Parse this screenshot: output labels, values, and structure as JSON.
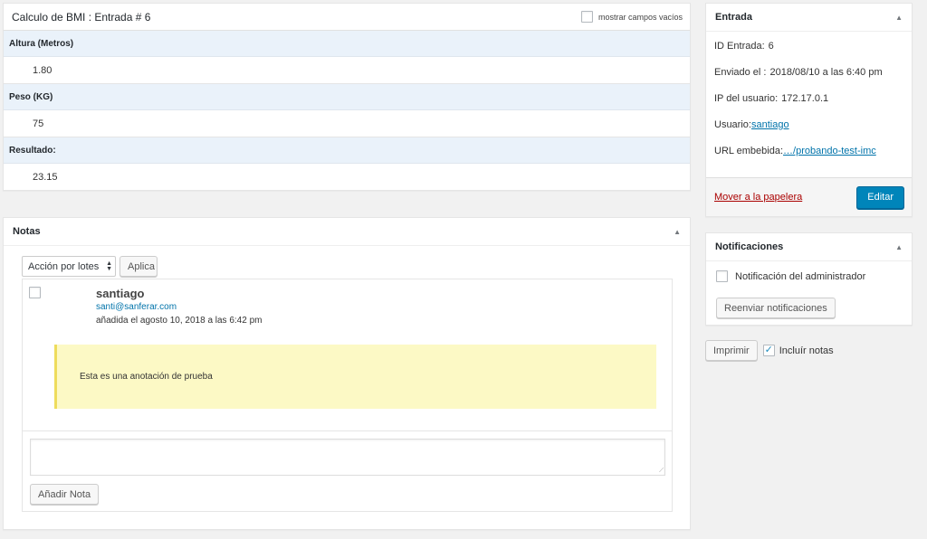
{
  "entry": {
    "title": "Calculo de BMI : Entrada # 6",
    "show_empty_label": "mostrar campos vacíos",
    "fields": [
      {
        "label": "Altura (Metros)",
        "value": "1.80"
      },
      {
        "label": "Peso (KG)",
        "value": "75"
      },
      {
        "label": "Resultado:",
        "value": "23.15"
      }
    ]
  },
  "notes": {
    "title": "Notas",
    "bulk_select": "Acción por lotes",
    "apply_label": "Aplica",
    "note": {
      "author": "santiago",
      "email": "santi@sanferar.com",
      "date": "añadida el agosto 10, 2018 a las 6:42 pm",
      "text": "Esta es una anotación de prueba"
    },
    "add_note_label": "Añadir Nota"
  },
  "entrada": {
    "title": "Entrada",
    "id_label": "ID Entrada:",
    "id_value": "6",
    "sent_label": "Enviado el :",
    "sent_value": "2018/08/10 a las 6:40 pm",
    "ip_label": "IP del usuario:",
    "ip_value": "172.17.0.1",
    "user_label": "Usuario:",
    "user_value": "santiago",
    "url_label": "URL embebida:",
    "url_value": "…/probando-test-imc",
    "trash_label": "Mover a la papelera",
    "edit_label": "Editar"
  },
  "notifications": {
    "title": "Notificaciones",
    "admin_label": "Notificación del administrador",
    "resend_label": "Reenviar notificaciones"
  },
  "print": {
    "print_label": "Imprimir",
    "include_notes_label": "Incluír notas",
    "include_notes_checked": true
  },
  "icons": {
    "toggle": "triangle-up-icon",
    "select_arrows": "select-arrows-icon",
    "resize": "resize-grip-icon",
    "check": "checkmark-icon"
  },
  "colors": {
    "accent": "#0085ba",
    "link": "#0073aa",
    "danger": "#a00",
    "note_bg": "#fcf9c5",
    "label_bg": "#eaf2fa"
  }
}
